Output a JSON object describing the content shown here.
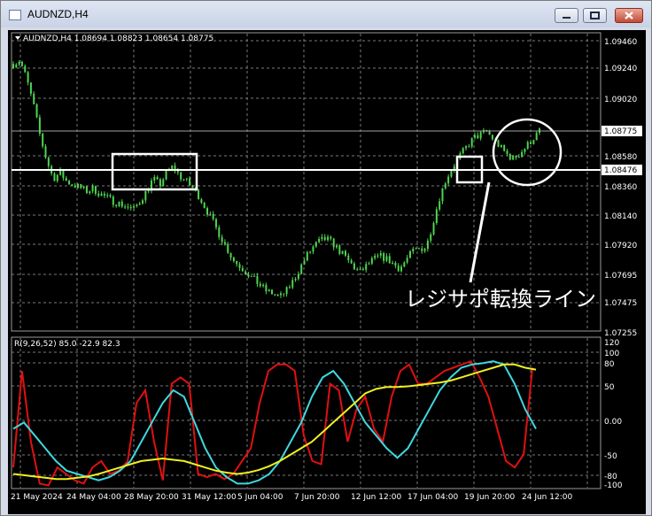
{
  "window": {
    "title": "AUDNZD,H4"
  },
  "chart_header": "AUDNZD,H4  1.08694 1.08823 1.08654 1.08775",
  "indicator_label": "R(9,26,52) 85.0 -22.9 82.3",
  "annotation_text": "レジサポ転換ライン",
  "price_axis": {
    "ticks": [
      "1.09460",
      "1.09240",
      "1.09020",
      "1.08580",
      "1.08360",
      "1.08140",
      "1.07920",
      "1.07695",
      "1.07475",
      "1.07255"
    ],
    "current_price": "1.08775",
    "line_price": "1.08476"
  },
  "indicator_axis": {
    "ticks": [
      "120",
      "100",
      "80",
      "50",
      "0.00",
      "-50",
      "-80",
      "-100"
    ]
  },
  "time_axis": {
    "ticks": [
      "21 May 2024",
      "24 May 04:00",
      "28 May 20:00",
      "31 May 12:00",
      "5 Jun 04:00",
      "7 Jun 20:00",
      "12 Jun 12:00",
      "17 Jun 04:00",
      "19 Jun 20:00",
      "24 Jun 12:00"
    ]
  },
  "colors": {
    "background": "#000000",
    "candles": "#4fd44f",
    "grid": "#7a7a7a",
    "line_red": "#e01010",
    "line_cyan": "#40d8e0",
    "line_yellow": "#f0f020",
    "annotation": "#ffffff"
  },
  "chart_data": [
    {
      "type": "line",
      "title": "AUDNZD,H4",
      "y_range": [
        1.0718,
        1.0957
      ],
      "series": [
        {
          "values": [
            1.0932,
            1.0935,
            1.092,
            1.09,
            1.0875,
            1.0855,
            1.084,
            1.0845,
            1.0838,
            1.0835,
            1.0833,
            1.083,
            1.0832,
            1.0828,
            1.0825,
            1.0822,
            1.082,
            1.0818,
            1.0815,
            1.0822,
            1.083,
            1.084,
            1.0835,
            1.0845,
            1.085,
            1.0842,
            1.0838,
            1.0832,
            1.0825,
            1.0815,
            1.0805,
            1.0795,
            1.0785,
            1.0775,
            1.077,
            1.0765,
            1.076,
            1.0755,
            1.075,
            1.0748,
            1.0745,
            1.075,
            1.0758,
            1.0768,
            1.0778,
            1.0785,
            1.079,
            1.0792,
            1.0788,
            1.0782,
            1.0776,
            1.077,
            1.0765,
            1.077,
            1.0775,
            1.0778,
            1.0776,
            1.0772,
            1.0768,
            1.0775,
            1.0782,
            1.0784,
            1.0785,
            1.0805,
            1.0825,
            1.084,
            1.085,
            1.0858,
            1.0865,
            1.0872,
            1.0875,
            1.0878,
            1.0872,
            1.0866,
            1.086,
            1.0856,
            1.086,
            1.0866,
            1.0872,
            1.0878
          ]
        }
      ]
    },
    {
      "type": "line",
      "title": "R(9,26,52) 85.0 -22.9 82.3",
      "y_range": [
        -100,
        120
      ],
      "series": [
        {
          "color": "#e01010",
          "values": [
            -70,
            80,
            -30,
            -95,
            -98,
            -70,
            -80,
            -90,
            -95,
            -70,
            -60,
            -80,
            -75,
            -60,
            30,
            50,
            -30,
            -90,
            60,
            70,
            60,
            -80,
            -85,
            -80,
            -88,
            -80,
            -60,
            -40,
            30,
            80,
            90,
            90,
            80,
            -20,
            -60,
            -65,
            60,
            50,
            -30,
            20,
            40,
            -10,
            -30,
            40,
            80,
            90,
            60,
            60,
            70,
            80,
            85,
            90,
            95,
            70,
            40,
            -10,
            -60,
            -70,
            -50,
            85
          ]
        },
        {
          "color": "#40d8e0",
          "values": [
            -10,
            0,
            -20,
            -40,
            -60,
            -75,
            -80,
            -85,
            -90,
            -85,
            -75,
            -60,
            -30,
            0,
            30,
            50,
            40,
            0,
            -40,
            -70,
            -85,
            -95,
            -95,
            -90,
            -80,
            -60,
            -30,
            0,
            40,
            70,
            80,
            60,
            30,
            0,
            -20,
            -40,
            -55,
            -40,
            -10,
            20,
            50,
            70,
            85,
            90,
            92,
            95,
            90,
            60,
            20,
            -10
          ]
        },
        {
          "color": "#f0f020",
          "values": [
            -80,
            -82,
            -84,
            -86,
            -88,
            -88,
            -86,
            -84,
            -80,
            -75,
            -70,
            -65,
            -60,
            -58,
            -56,
            -58,
            -60,
            -65,
            -70,
            -75,
            -78,
            -80,
            -78,
            -74,
            -68,
            -60,
            -50,
            -40,
            -30,
            -15,
            0,
            15,
            30,
            45,
            52,
            55,
            55,
            56,
            58,
            60,
            62,
            65,
            70,
            75,
            80,
            85,
            90,
            90,
            85,
            82
          ]
        }
      ]
    }
  ]
}
